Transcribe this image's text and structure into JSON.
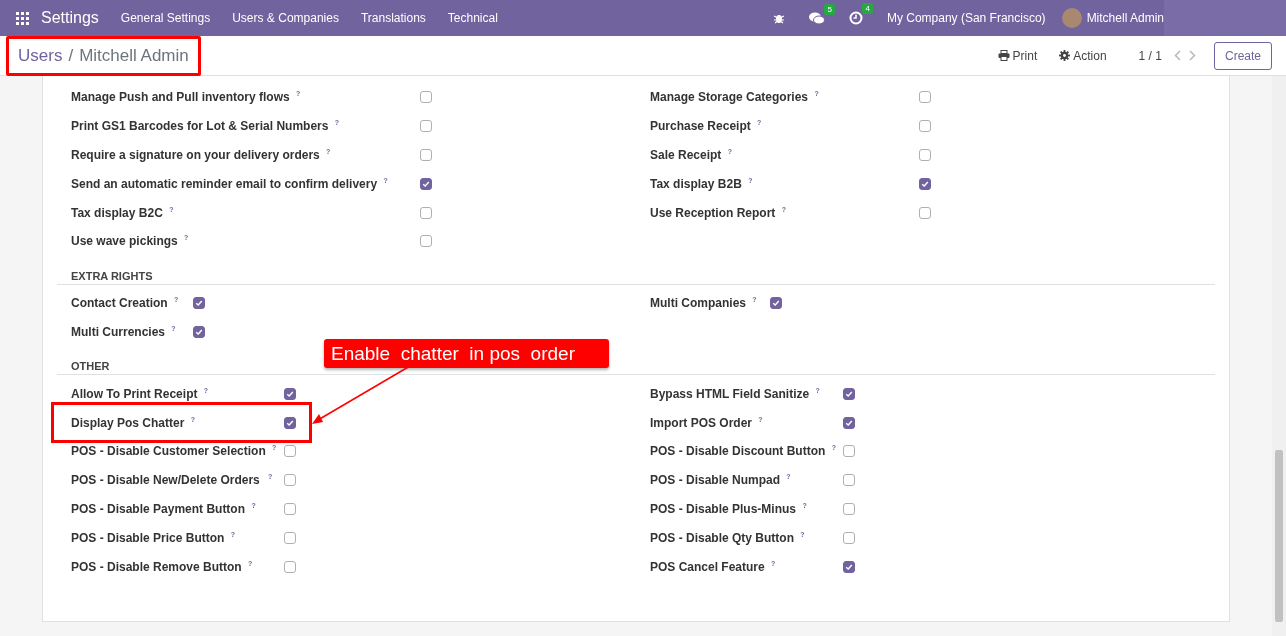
{
  "navbar": {
    "app_title": "Settings",
    "menus": [
      "General Settings",
      "Users & Companies",
      "Translations",
      "Technical"
    ],
    "messages_badge": "5",
    "activities_badge": "4",
    "company": "My Company (San Francisco)",
    "user": "Mitchell Admin"
  },
  "control_panel": {
    "breadcrumb": [
      {
        "label": "Users"
      },
      {
        "label": "Mitchell Admin"
      }
    ],
    "separator": "/",
    "highlighted": true,
    "print": "Print",
    "action": "Action",
    "pager": "1 / 1",
    "create": "Create"
  },
  "sections": [
    {
      "rows": [
        [
          {
            "label": "Manage Push and Pull inventory flows $^{?}$",
            "checked": false,
            "highlighted": false
          },
          {
            "label": "Manage Storage Categories $^{?}$",
            "checked": false,
            "highlighted": false
          }
        ],
        [
          {
            "label": "Print GS1 Barcodes for Lot & Serial Numbers $^{?}$",
            "checked": false,
            "highlighted": false
          },
          {
            "label": "Purchase Receipt $^{?}$",
            "checked": false,
            "highlighted": false
          }
        ],
        [
          {
            "label": "Require a signature on your delivery orders $^{?}$",
            "checked": false,
            "highlighted": false
          },
          {
            "label": "Sale Receipt $^{?}$",
            "checked": false,
            "highlighted": false
          }
        ],
        [
          {
            "label": "Send an automatic reminder email to confirm delivery $^{?}$",
            "checked": true,
            "highlighted": false
          },
          {
            "label": "Tax display B2B $^{?}$",
            "checked": true,
            "highlighted": false
          }
        ],
        [
          {
            "label": "Tax display B2C $^{?}$",
            "checked": false,
            "highlighted": false
          },
          {
            "label": "Use Reception Report $^{?}$",
            "checked": false,
            "highlighted": false
          }
        ],
        [
          {
            "label": "Use wave pickings $^{?}$",
            "checked": false,
            "highlighted": false
          }
        ]
      ]
    },
    {
      "title": "EXTRA RIGHTS",
      "rows": [
        [
          {
            "label": "Contact Creation $^{?}$",
            "checked": true,
            "highlighted": false
          },
          {
            "label": "Multi Companies $^{?}$",
            "checked": true,
            "highlighted": false
          }
        ],
        [
          {
            "label": "Multi Currencies $^{?}$",
            "checked": true,
            "highlighted": false
          }
        ]
      ]
    },
    {
      "title": "OTHER",
      "rows": [
        [
          {
            "label": "Allow To Print Receipt $^{?}$",
            "checked": true,
            "highlighted": false
          },
          {
            "label": "Bypass HTML Field Sanitize $^{?}$",
            "checked": true,
            "highlighted": false
          }
        ],
        [
          {
            "label": "Display Pos Chatter $^{?}$",
            "checked": true,
            "highlighted": true
          },
          {
            "label": "Import POS Order $^{?}$",
            "checked": true,
            "highlighted": false
          }
        ],
        [
          {
            "label": "POS - Disable Customer Selection $^{?}$",
            "checked": false,
            "highlighted": false
          },
          {
            "label": "POS - Disable Discount Button $^{?}$",
            "checked": false,
            "highlighted": false
          }
        ],
        [
          {
            "label": "POS - Disable New/Delete Orders $^{ ?}$",
            "checked": false,
            "highlighted": false
          },
          {
            "label": "POS - Disable Numpad $^{?}$",
            "checked": false,
            "highlighted": false
          }
        ],
        [
          {
            "label": "POS - Disable Payment Button $^{?}$",
            "checked": false,
            "highlighted": false
          },
          {
            "label": "POS - Disable Plus-Minus $^{?}$",
            "checked": false,
            "highlighted": false
          }
        ],
        [
          {
            "label": "POS - Disable Price Button $^{?}$",
            "checked": false,
            "highlighted": false
          },
          {
            "label": "POS - Disable Qty Button $^{?}$",
            "checked": false,
            "highlighted": false
          }
        ],
        [
          {
            "label": "POS - Disable Remove Button $^{?}$",
            "checked": false,
            "highlighted": false
          },
          {
            "label": "POS Cancel Feature $^{?}$",
            "checked": true,
            "highlighted": false
          }
        ]
      ]
    }
  ],
  "annotation": {
    "text": "Enable  chatter  in pos  order"
  }
}
